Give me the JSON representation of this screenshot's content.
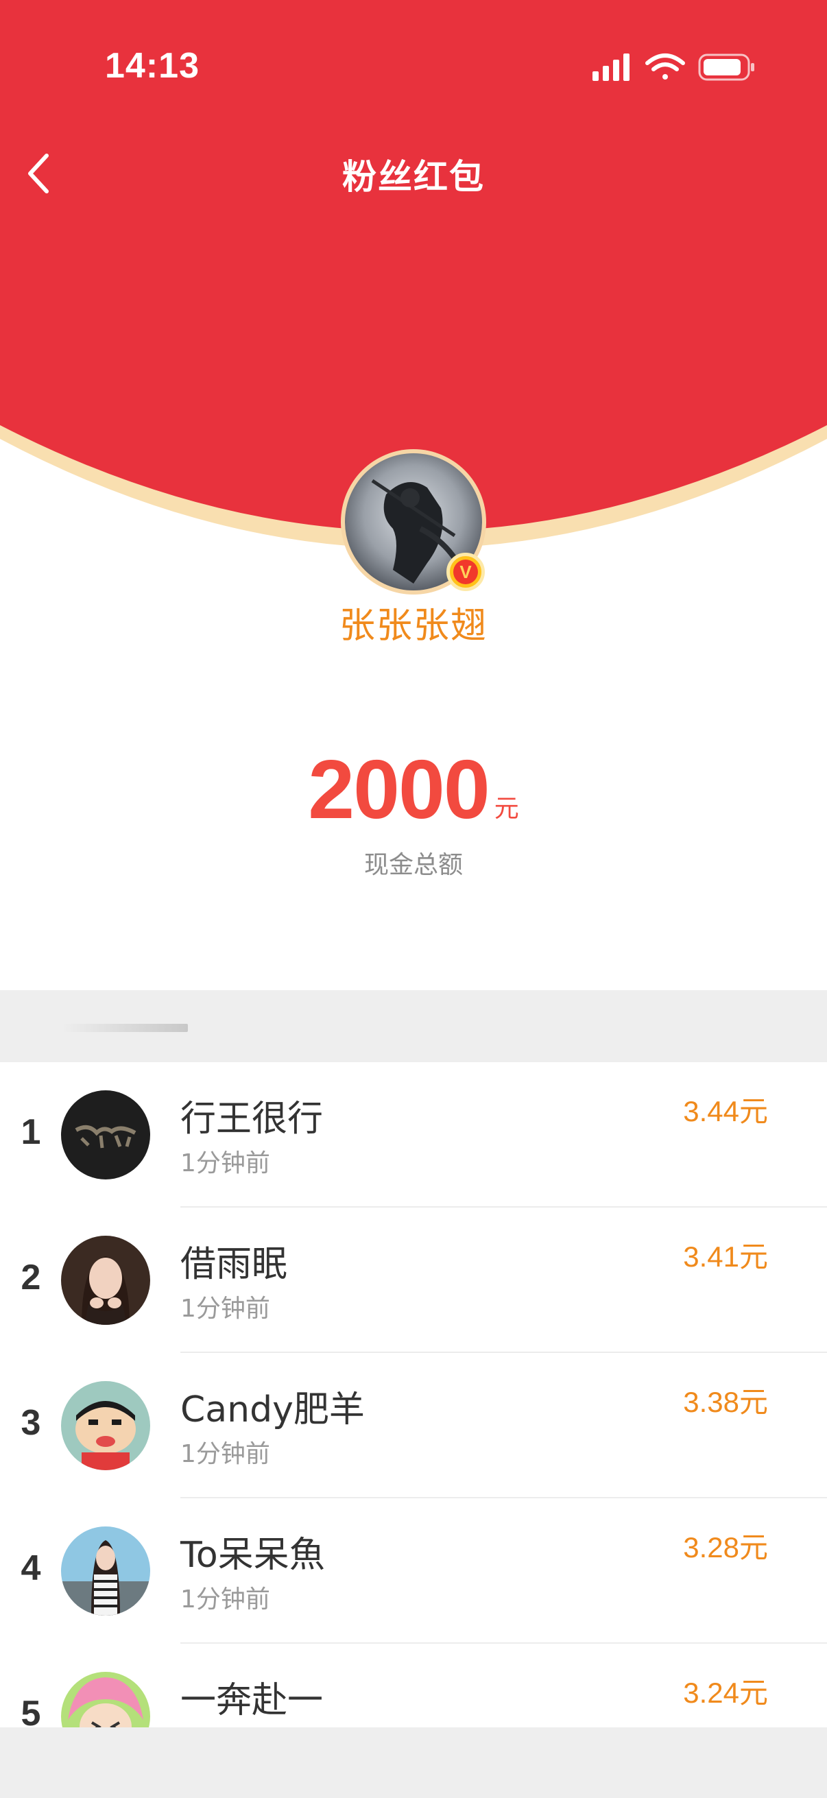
{
  "status_bar": {
    "time": "14:13",
    "signal_icon": "cellular-signal-icon",
    "wifi_icon": "wifi-icon",
    "battery_icon": "battery-icon"
  },
  "nav": {
    "back_icon": "chevron-left-icon",
    "title": "粉丝红包"
  },
  "sender": {
    "nickname": "张张张翅",
    "verified_badge": "V"
  },
  "summary": {
    "amount": "2000",
    "unit": "元",
    "label": "现金总额"
  },
  "recipients": [
    {
      "rank": "1",
      "name": "行王很行",
      "time": "1分钟前",
      "amount": "3.44元"
    },
    {
      "rank": "2",
      "name": "借雨眠",
      "time": "1分钟前",
      "amount": "3.41元"
    },
    {
      "rank": "3",
      "name": "Candy肥羊",
      "time": "1分钟前",
      "amount": "3.38元"
    },
    {
      "rank": "4",
      "name": "To呆呆魚",
      "time": "1分钟前",
      "amount": "3.28元"
    },
    {
      "rank": "5",
      "name": "一奔赴一",
      "time": "",
      "amount": "3.24元"
    }
  ],
  "colors": {
    "header_red": "#e8323d",
    "gold_rim": "#f9dfb0",
    "amount_red": "#f24a3f",
    "accent_orange": "#f08a1c"
  }
}
